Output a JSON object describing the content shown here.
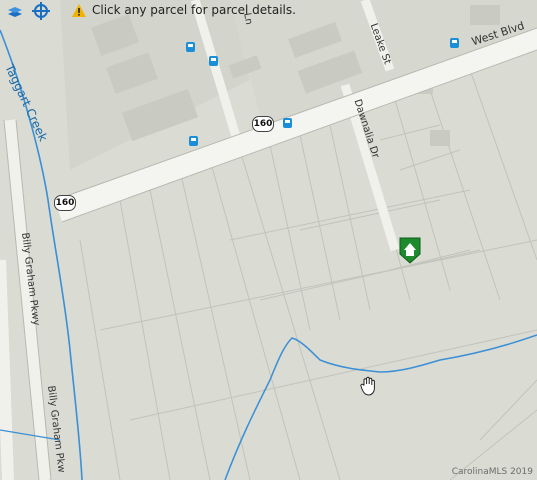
{
  "toolbar": {
    "icons": [
      "layers-icon",
      "crosshair-icon"
    ]
  },
  "notice": {
    "text": "Click any parcel for parcel details.",
    "icon": "warning-icon"
  },
  "map": {
    "roads": {
      "west_blvd": "West Blvd",
      "leake_st": "Leake St",
      "dawnalia_dr": "Dawnalia Dr",
      "billy_graham_1": "Billy Graham Pkwy",
      "billy_graham_2": "Billy Graham Pkw",
      "ln": "Ln",
      "hwy": "160"
    },
    "creek": "Taggart Creek",
    "listing_icon": "home-listing-pin-icon",
    "cursor_icon": "hand-cursor-icon"
  },
  "copyright": "CarolinaMLS 2019",
  "colors": {
    "background": "#dcdcd4",
    "road": "#f3f3ef",
    "creek": "#3a8fd6",
    "pin": "#1e8a2e"
  }
}
